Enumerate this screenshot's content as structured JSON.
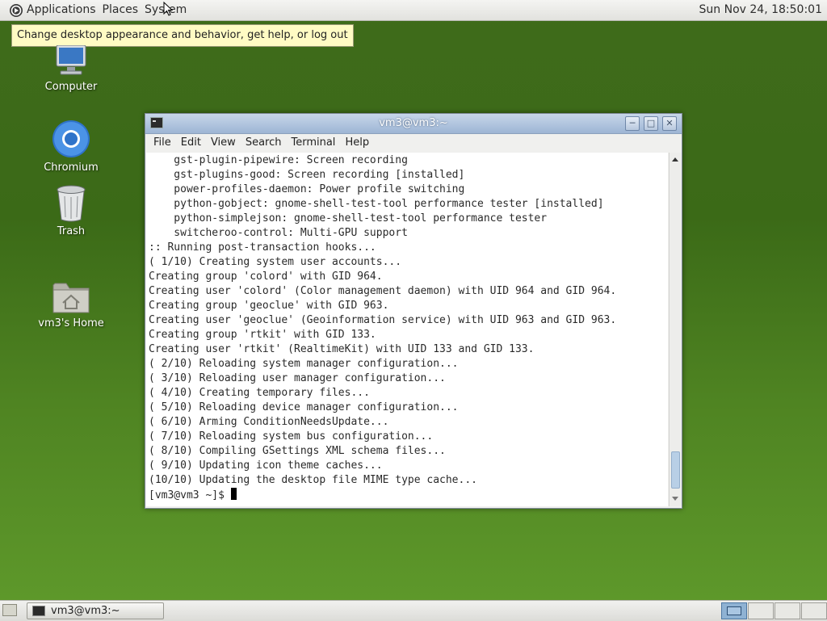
{
  "top_panel": {
    "menus": [
      "Applications",
      "Places",
      "System"
    ],
    "clock": "Sun Nov 24, 18:50:01"
  },
  "tooltip": "Change desktop appearance and behavior, get help, or log out",
  "desktop_icons": [
    {
      "label": "Computer",
      "icon": "computer-icon"
    },
    {
      "label": "Chromium",
      "icon": "chromium-icon"
    },
    {
      "label": "Trash",
      "icon": "trash-icon"
    },
    {
      "label": "vm3's Home",
      "icon": "home-folder-icon"
    }
  ],
  "terminal": {
    "title": "vm3@vm3:~",
    "menu": [
      "File",
      "Edit",
      "View",
      "Search",
      "Terminal",
      "Help"
    ],
    "lines": [
      "    gst-plugin-pipewire: Screen recording",
      "    gst-plugins-good: Screen recording [installed]",
      "    power-profiles-daemon: Power profile switching",
      "    python-gobject: gnome-shell-test-tool performance tester [installed]",
      "    python-simplejson: gnome-shell-test-tool performance tester",
      "    switcheroo-control: Multi-GPU support",
      ":: Running post-transaction hooks...",
      "( 1/10) Creating system user accounts...",
      "Creating group 'colord' with GID 964.",
      "Creating user 'colord' (Color management daemon) with UID 964 and GID 964.",
      "Creating group 'geoclue' with GID 963.",
      "Creating user 'geoclue' (Geoinformation service) with UID 963 and GID 963.",
      "Creating group 'rtkit' with GID 133.",
      "Creating user 'rtkit' (RealtimeKit) with UID 133 and GID 133.",
      "( 2/10) Reloading system manager configuration...",
      "( 3/10) Reloading user manager configuration...",
      "( 4/10) Creating temporary files...",
      "( 5/10) Reloading device manager configuration...",
      "( 6/10) Arming ConditionNeedsUpdate...",
      "( 7/10) Reloading system bus configuration...",
      "( 8/10) Compiling GSettings XML schema files...",
      "( 9/10) Updating icon theme caches...",
      "(10/10) Updating the desktop file MIME type cache..."
    ],
    "prompt": "[vm3@vm3 ~]$ "
  },
  "taskbar": {
    "task_label": "vm3@vm3:~"
  },
  "colors": {
    "desktop": "#4a7d1f",
    "titlebar": "#a9bfdc",
    "tooltip": "#fffbc4"
  }
}
